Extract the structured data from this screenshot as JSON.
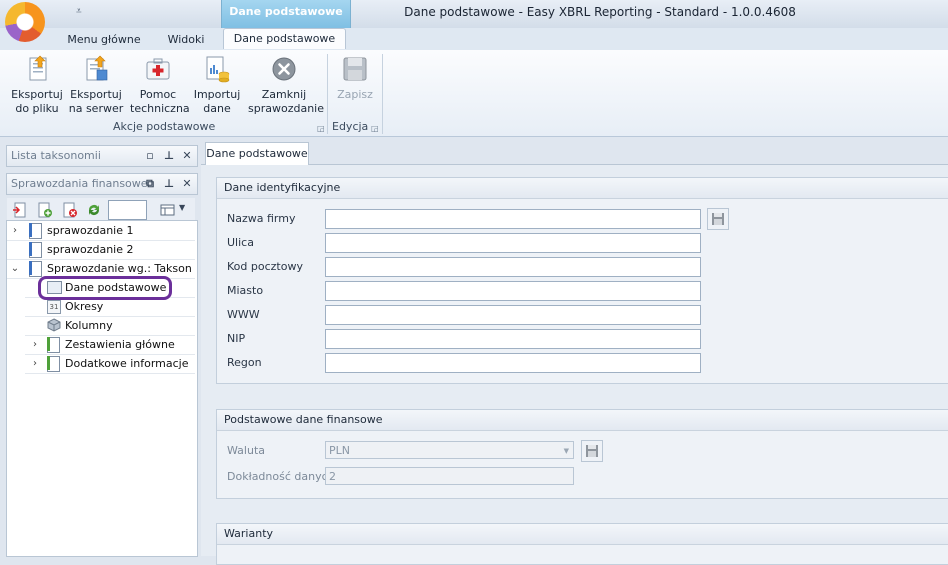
{
  "window": {
    "title": "Dane podstawowe - Easy XBRL Reporting - Standard - 1.0.0.4608",
    "context_tab": "Dane podstawowe",
    "qat_glyph": "⩡"
  },
  "ribbon": {
    "tabs": [
      "Menu główne",
      "Widoki",
      "Dane podstawowe"
    ],
    "active_tab": "Dane podstawowe",
    "groups": [
      {
        "label": "Akcje podstawowe",
        "buttons": [
          {
            "line1": "Eksportuj",
            "line2": "do pliku",
            "icon": "export-file-icon"
          },
          {
            "line1": "Eksportuj",
            "line2": "na serwer",
            "icon": "export-server-icon"
          },
          {
            "line1": "Pomoc",
            "line2": "techniczna",
            "icon": "help-kit-icon"
          },
          {
            "line1": "Importuj",
            "line2": "dane",
            "icon": "import-icon"
          },
          {
            "line1": "Zamknij",
            "line2": "sprawozdanie",
            "icon": "close-report-icon"
          }
        ]
      },
      {
        "label": "Edycja",
        "buttons": [
          {
            "line1": "Zapisz",
            "line2": "",
            "icon": "save-icon",
            "disabled": true
          }
        ]
      }
    ]
  },
  "left_panel": {
    "taxonomy_pane_title": "Lista taksonomii",
    "reports_pane_title": "Sprawozdania finansowe",
    "filter_value": "",
    "tree": [
      {
        "label": "sprawozdanie 1",
        "level": 0,
        "expander": "›",
        "icon": "blue"
      },
      {
        "label": "sprawozdanie 2",
        "level": 0,
        "expander": "",
        "icon": "blue"
      },
      {
        "label": "Sprawozdanie wg.: Takson...",
        "level": 0,
        "expander": "⌄",
        "icon": "doc"
      },
      {
        "label": "Dane podstawowe",
        "level": 1,
        "expander": "",
        "icon": "form",
        "selected": true
      },
      {
        "label": "Okresy",
        "level": 1,
        "expander": "",
        "icon": "calendar"
      },
      {
        "label": "Kolumny",
        "level": 1,
        "expander": "",
        "icon": "cube"
      },
      {
        "label": "Zestawienia główne",
        "level": 1,
        "expander": "›",
        "icon": "green"
      },
      {
        "label": "Dodatkowe informacje i ...",
        "level": 1,
        "expander": "›",
        "icon": "green"
      }
    ]
  },
  "main": {
    "document_tab": "Dane podstawowe",
    "identification": {
      "title": "Dane identyfikacyjne",
      "fields": [
        {
          "label": "Nazwa firmy",
          "value": ""
        },
        {
          "label": "Ulica",
          "value": ""
        },
        {
          "label": "Kod pocztowy",
          "value": ""
        },
        {
          "label": "Miasto",
          "value": ""
        },
        {
          "label": "WWW",
          "value": ""
        },
        {
          "label": "NIP",
          "value": ""
        },
        {
          "label": "Regon",
          "value": ""
        }
      ]
    },
    "financial": {
      "title": "Podstawowe dane finansowe",
      "currency_label": "Waluta",
      "currency_value": "PLN",
      "precision_label": "Dokładność danych",
      "precision_value": "2"
    },
    "variants": {
      "title": "Warianty"
    }
  }
}
